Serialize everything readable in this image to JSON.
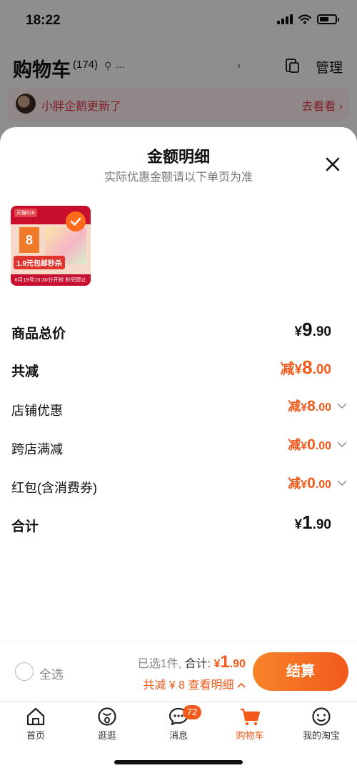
{
  "status_bar": {
    "time": "18:22"
  },
  "cart_header": {
    "title": "购物车",
    "count": "(174)",
    "location": "...",
    "manage_label": "管理"
  },
  "banner": {
    "text": "小胖企鹅更新了",
    "link": "去看看"
  },
  "sheet": {
    "title": "金额明细",
    "subtitle": "实际优惠金额请以下单页为准",
    "product_thumb": {
      "brand": "天猫618",
      "badge": "8",
      "price_tag": "1.9元包邮秒杀",
      "date_text": "6月19号15:30分开抢 秒完即止"
    },
    "rows": [
      {
        "label": "商品总价",
        "prefix": "",
        "symbol": "¥",
        "int": "9",
        "dec": ".90"
      },
      {
        "label": "共减",
        "prefix": "减",
        "symbol": "¥",
        "int": "8",
        "dec": ".00"
      },
      {
        "label": "店铺优惠",
        "prefix": "减",
        "symbol": "¥",
        "int": "8",
        "dec": ".00"
      },
      {
        "label": "跨店满减",
        "prefix": "减",
        "symbol": "¥",
        "int": "0",
        "dec": ".00"
      },
      {
        "label": "红包(含消费券)",
        "prefix": "减",
        "symbol": "¥",
        "int": "0",
        "dec": ".00"
      },
      {
        "label": "合计",
        "prefix": "",
        "symbol": "¥",
        "int": "1",
        "dec": ".90"
      }
    ]
  },
  "action_bar": {
    "select_all": "全选",
    "selected_text": "已选1件,",
    "total_label": "合计:",
    "total_symbol": "¥",
    "total_int": "1",
    "total_dec": ".90",
    "discount_text": "共减 ¥ 8",
    "detail_link": "查看明细",
    "checkout_label": "结算"
  },
  "tabbar": {
    "tabs": [
      {
        "label": "首页"
      },
      {
        "label": "逛逛"
      },
      {
        "label": "消息",
        "badge": "72"
      },
      {
        "label": "购物车"
      },
      {
        "label": "我的淘宝"
      }
    ]
  },
  "colors": {
    "accent": "#f25a1b",
    "banner_text": "#e2384a"
  }
}
